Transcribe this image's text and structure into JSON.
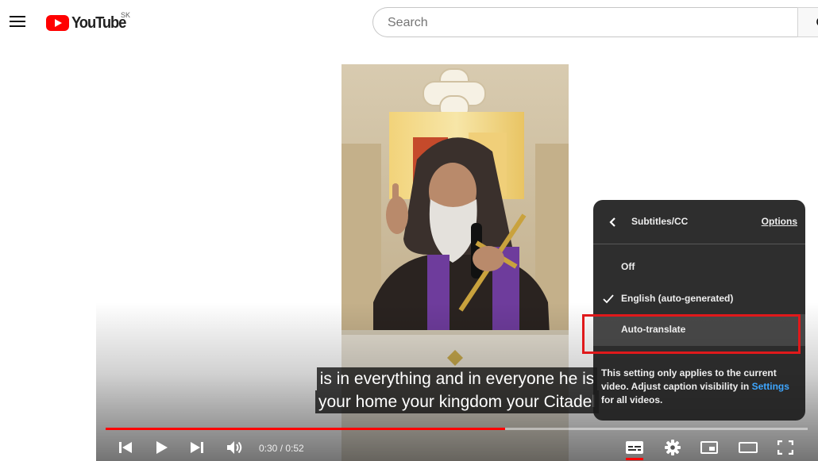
{
  "masthead": {
    "logo_text": "YouTube",
    "country_code": "SK",
    "search_placeholder": "Search",
    "icons": [
      "hamburger-menu-icon",
      "youtube-logo-icon",
      "search-icon"
    ]
  },
  "player": {
    "caption_lines": [
      "is in everything and in everyone he is",
      "your home your kingdom your Citadel"
    ],
    "time_display": "0:30 / 0:52",
    "progress_fraction": 0.569,
    "controls_icons": [
      "previous-icon",
      "play-icon",
      "next-icon",
      "volume-icon",
      "subtitles-icon",
      "settings-gear-icon",
      "miniplayer-icon",
      "theater-mode-icon",
      "fullscreen-icon"
    ],
    "subtitles_active": true
  },
  "subtitles_menu": {
    "title": "Subtitles/CC",
    "options_label": "Options",
    "items": [
      {
        "label": "Off",
        "selected": false
      },
      {
        "label": "English (auto-generated)",
        "selected": true
      },
      {
        "label": "Auto-translate",
        "selected": false
      }
    ],
    "note_prefix": "This setting only applies to the current video. Adjust caption visibility in ",
    "note_link": "Settings",
    "note_suffix": " for all videos."
  },
  "colors": {
    "brand_red": "#ff0000",
    "highlight_box": "#e0191b",
    "link_blue": "#3ea6ff",
    "menu_bg": "#1c1c1c"
  }
}
